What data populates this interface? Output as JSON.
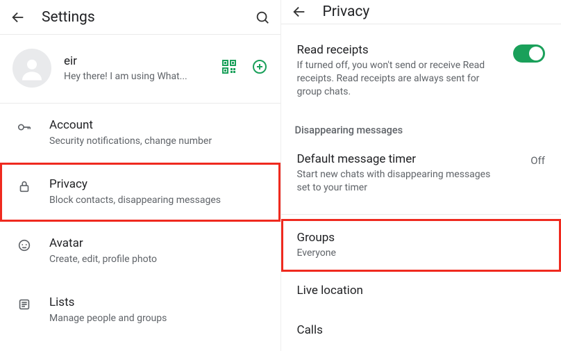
{
  "left": {
    "appbar_title": "Settings",
    "profile": {
      "name": "eir",
      "status": "Hey there! I am using What..."
    },
    "items": [
      {
        "title": "Account",
        "subtitle": "Security notifications, change number"
      },
      {
        "title": "Privacy",
        "subtitle": "Block contacts, disappearing messages"
      },
      {
        "title": "Avatar",
        "subtitle": "Create, edit, profile photo"
      },
      {
        "title": "Lists",
        "subtitle": "Manage people and groups"
      }
    ]
  },
  "right": {
    "appbar_title": "Privacy",
    "read_receipts": {
      "title": "Read receipts",
      "desc": "If turned off, you won't send or receive Read receipts. Read receipts are always sent for group chats.",
      "enabled": true
    },
    "section_disappearing": "Disappearing messages",
    "default_timer": {
      "title": "Default message timer",
      "desc": "Start new chats with disappearing messages set to your timer",
      "value": "Off"
    },
    "groups": {
      "title": "Groups",
      "subtitle": "Everyone"
    },
    "live_location": {
      "title": "Live location"
    },
    "calls": {
      "title": "Calls"
    }
  }
}
